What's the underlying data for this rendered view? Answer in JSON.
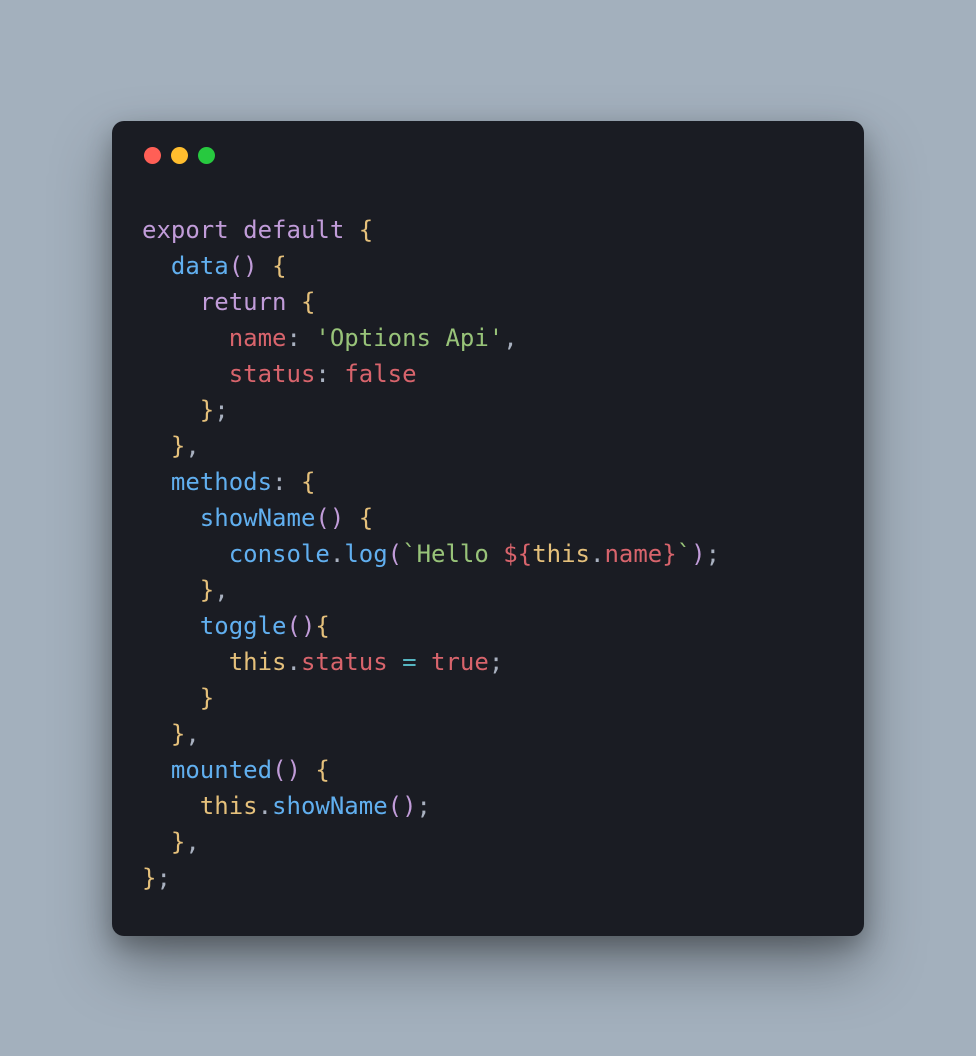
{
  "window": {
    "traffic_lights": {
      "red": "#ff5f56",
      "yellow": "#ffbd2e",
      "green": "#27c93f"
    }
  },
  "syntax_colors": {
    "keyword": "#c19cd9",
    "default": "#a9b1c0",
    "fn": "#61afef",
    "brace": "#e5c07b",
    "paren": "#c19cd9",
    "prop": "#d8646c",
    "string": "#98c379",
    "literal": "#d8646c",
    "punct": "#a9b1c0",
    "this": "#e5c07b",
    "member": "#d8646c",
    "dot": "#a9b1c0",
    "op": "#56b6c2",
    "tpl": "#d8646c"
  },
  "code": {
    "lines": [
      [
        {
          "t": "export",
          "c": "keyword"
        },
        {
          "t": " ",
          "c": "default"
        },
        {
          "t": "default",
          "c": "keyword"
        },
        {
          "t": " ",
          "c": "default"
        },
        {
          "t": "{",
          "c": "brace"
        }
      ],
      [
        {
          "t": "  ",
          "c": "default"
        },
        {
          "t": "data",
          "c": "fn"
        },
        {
          "t": "(",
          "c": "paren"
        },
        {
          "t": ")",
          "c": "paren"
        },
        {
          "t": " ",
          "c": "default"
        },
        {
          "t": "{",
          "c": "brace"
        }
      ],
      [
        {
          "t": "    ",
          "c": "default"
        },
        {
          "t": "return",
          "c": "keyword"
        },
        {
          "t": " ",
          "c": "default"
        },
        {
          "t": "{",
          "c": "brace"
        }
      ],
      [
        {
          "t": "      ",
          "c": "default"
        },
        {
          "t": "name",
          "c": "prop"
        },
        {
          "t": ":",
          "c": "punct"
        },
        {
          "t": " ",
          "c": "default"
        },
        {
          "t": "'Options Api'",
          "c": "string"
        },
        {
          "t": ",",
          "c": "punct"
        }
      ],
      [
        {
          "t": "      ",
          "c": "default"
        },
        {
          "t": "status",
          "c": "prop"
        },
        {
          "t": ":",
          "c": "punct"
        },
        {
          "t": " ",
          "c": "default"
        },
        {
          "t": "false",
          "c": "literal"
        }
      ],
      [
        {
          "t": "    ",
          "c": "default"
        },
        {
          "t": "}",
          "c": "brace"
        },
        {
          "t": ";",
          "c": "punct"
        }
      ],
      [
        {
          "t": "  ",
          "c": "default"
        },
        {
          "t": "}",
          "c": "brace"
        },
        {
          "t": ",",
          "c": "punct"
        }
      ],
      [
        {
          "t": "  ",
          "c": "default"
        },
        {
          "t": "methods",
          "c": "fn"
        },
        {
          "t": ":",
          "c": "punct"
        },
        {
          "t": " ",
          "c": "default"
        },
        {
          "t": "{",
          "c": "brace"
        }
      ],
      [
        {
          "t": "    ",
          "c": "default"
        },
        {
          "t": "showName",
          "c": "fn"
        },
        {
          "t": "(",
          "c": "paren"
        },
        {
          "t": ")",
          "c": "paren"
        },
        {
          "t": " ",
          "c": "default"
        },
        {
          "t": "{",
          "c": "brace"
        }
      ],
      [
        {
          "t": "      ",
          "c": "default"
        },
        {
          "t": "console",
          "c": "fn"
        },
        {
          "t": ".",
          "c": "dot"
        },
        {
          "t": "log",
          "c": "fn"
        },
        {
          "t": "(",
          "c": "paren"
        },
        {
          "t": "`Hello ",
          "c": "string"
        },
        {
          "t": "${",
          "c": "tpl"
        },
        {
          "t": "this",
          "c": "this"
        },
        {
          "t": ".",
          "c": "dot"
        },
        {
          "t": "name",
          "c": "member"
        },
        {
          "t": "}",
          "c": "tpl"
        },
        {
          "t": "`",
          "c": "string"
        },
        {
          "t": ")",
          "c": "paren"
        },
        {
          "t": ";",
          "c": "punct"
        }
      ],
      [
        {
          "t": "    ",
          "c": "default"
        },
        {
          "t": "}",
          "c": "brace"
        },
        {
          "t": ",",
          "c": "punct"
        }
      ],
      [
        {
          "t": "    ",
          "c": "default"
        },
        {
          "t": "toggle",
          "c": "fn"
        },
        {
          "t": "(",
          "c": "paren"
        },
        {
          "t": ")",
          "c": "paren"
        },
        {
          "t": "{",
          "c": "brace"
        }
      ],
      [
        {
          "t": "      ",
          "c": "default"
        },
        {
          "t": "this",
          "c": "this"
        },
        {
          "t": ".",
          "c": "dot"
        },
        {
          "t": "status",
          "c": "member"
        },
        {
          "t": " ",
          "c": "default"
        },
        {
          "t": "=",
          "c": "op"
        },
        {
          "t": " ",
          "c": "default"
        },
        {
          "t": "true",
          "c": "literal"
        },
        {
          "t": ";",
          "c": "punct"
        }
      ],
      [
        {
          "t": "    ",
          "c": "default"
        },
        {
          "t": "}",
          "c": "brace"
        }
      ],
      [
        {
          "t": "  ",
          "c": "default"
        },
        {
          "t": "}",
          "c": "brace"
        },
        {
          "t": ",",
          "c": "punct"
        }
      ],
      [
        {
          "t": "  ",
          "c": "default"
        },
        {
          "t": "mounted",
          "c": "fn"
        },
        {
          "t": "(",
          "c": "paren"
        },
        {
          "t": ")",
          "c": "paren"
        },
        {
          "t": " ",
          "c": "default"
        },
        {
          "t": "{",
          "c": "brace"
        }
      ],
      [
        {
          "t": "    ",
          "c": "default"
        },
        {
          "t": "this",
          "c": "this"
        },
        {
          "t": ".",
          "c": "dot"
        },
        {
          "t": "showName",
          "c": "fn"
        },
        {
          "t": "(",
          "c": "paren"
        },
        {
          "t": ")",
          "c": "paren"
        },
        {
          "t": ";",
          "c": "punct"
        }
      ],
      [
        {
          "t": "  ",
          "c": "default"
        },
        {
          "t": "}",
          "c": "brace"
        },
        {
          "t": ",",
          "c": "punct"
        }
      ],
      [
        {
          "t": "}",
          "c": "brace"
        },
        {
          "t": ";",
          "c": "punct"
        }
      ]
    ]
  }
}
